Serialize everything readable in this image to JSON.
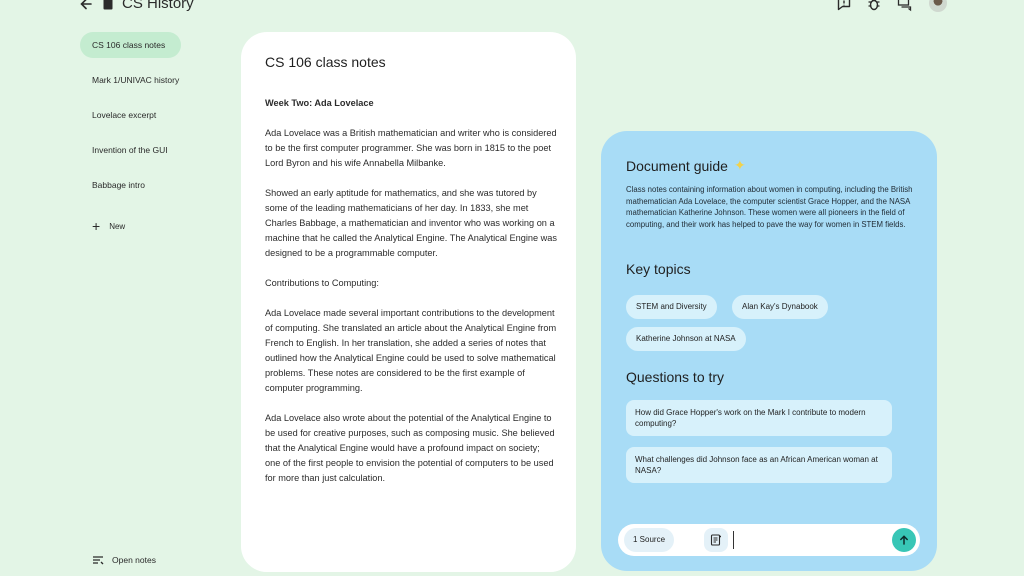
{
  "header": {
    "title": "CS History",
    "icons": [
      "back-arrow-icon",
      "notebook-icon",
      "feedback-icon",
      "bug-icon",
      "chat-icon",
      "avatar"
    ]
  },
  "sidebar": {
    "items": [
      {
        "label": "CS 106 class notes",
        "active": true
      },
      {
        "label": "Mark 1/UNIVAC history"
      },
      {
        "label": "Lovelace excerpt"
      },
      {
        "label": "Invention of the GUI"
      },
      {
        "label": "Babbage intro"
      }
    ],
    "new_label": "New",
    "open_notes_label": "Open notes"
  },
  "document": {
    "title": "CS 106 class notes",
    "heading": "Week Two: Ada Lovelace",
    "paragraphs": [
      "Ada Lovelace was a British mathematician and writer who is considered to be the first computer programmer. She was born in 1815 to the poet Lord Byron and his wife Annabella Milbanke.",
      "Showed an early aptitude for mathematics, and she was tutored by some of the leading mathematicians of her day. In 1833, she met Charles Babbage, a mathematician and inventor who was working on a machine that he called the Analytical Engine. The Analytical Engine was designed to be a programmable computer.",
      "Contributions to Computing:",
      "Ada Lovelace made several important contributions to the development of computing. She translated an article about the Analytical Engine from French to English. In her translation, she added a series of notes that outlined how the Analytical Engine could be used to solve mathematical problems. These notes are considered to be the first example of computer programming.",
      "Ada Lovelace also wrote about the potential of the Analytical Engine to be used for creative purposes, such as composing music. She believed that the Analytical Engine would have a profound impact on society; one of the first people to envision the potential of computers to be used for more than just calculation."
    ]
  },
  "guide": {
    "title": "Document guide",
    "summary": "Class notes containing information about women in computing, including the British mathematician Ada Lovelace, the computer scientist Grace Hopper, and the NASA mathematician Katherine Johnson. These women were all pioneers in the field of computing, and their work has helped to pave the way for women in STEM fields.",
    "key_topics_title": "Key topics",
    "topics": [
      "STEM and Diversity",
      "Alan Kay's Dynabook",
      "Katherine Johnson at NASA"
    ],
    "questions_title": "Questions to try",
    "questions": [
      "How did Grace Hopper's work on the Mark I contribute to modern computing?",
      "What challenges did Johnson face as an African American woman at NASA?"
    ],
    "input": {
      "source_label": "1 Source",
      "value": "",
      "accent": "#38c6b6"
    }
  },
  "colors": {
    "background": "#e3f5e6",
    "active_item": "#c4ecd0",
    "guide_panel": "#a8dcf6",
    "chip": "#d7f1fb"
  }
}
